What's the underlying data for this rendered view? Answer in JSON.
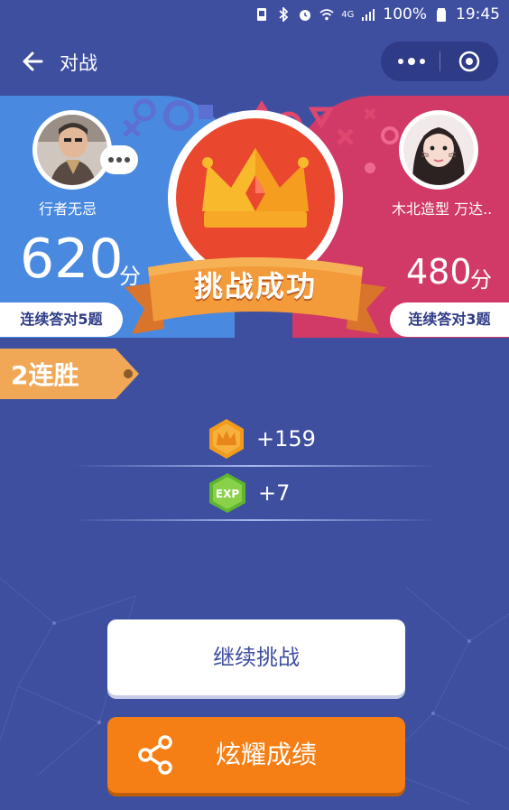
{
  "status_bar": {
    "battery": "100%",
    "time": "19:45",
    "network": "4G"
  },
  "nav": {
    "title": "对战"
  },
  "players": {
    "left": {
      "name": "行者无忌",
      "score": "620",
      "unit": "分",
      "streak": "连续答对5题"
    },
    "right": {
      "name": "木北造型 万达..",
      "score": "480",
      "unit": "分",
      "streak": "连续答对3题"
    }
  },
  "result": {
    "banner": "挑战成功",
    "win_streak": "2连胜"
  },
  "rewards": {
    "coins": "+159",
    "exp_label": "EXP",
    "exp": "+7"
  },
  "buttons": {
    "continue": "继续挑战",
    "share": "炫耀成绩"
  },
  "colors": {
    "background": "#3f4fa0",
    "left_panel": "#4a89e0",
    "right_panel": "#d13a67",
    "share_button": "#f57f14",
    "ribbon": "#f39a3a"
  },
  "icons": [
    "back-arrow-icon",
    "more-dots-icon",
    "close-target-icon",
    "crown-icon",
    "coin-crown-icon",
    "exp-icon",
    "share-icon"
  ]
}
